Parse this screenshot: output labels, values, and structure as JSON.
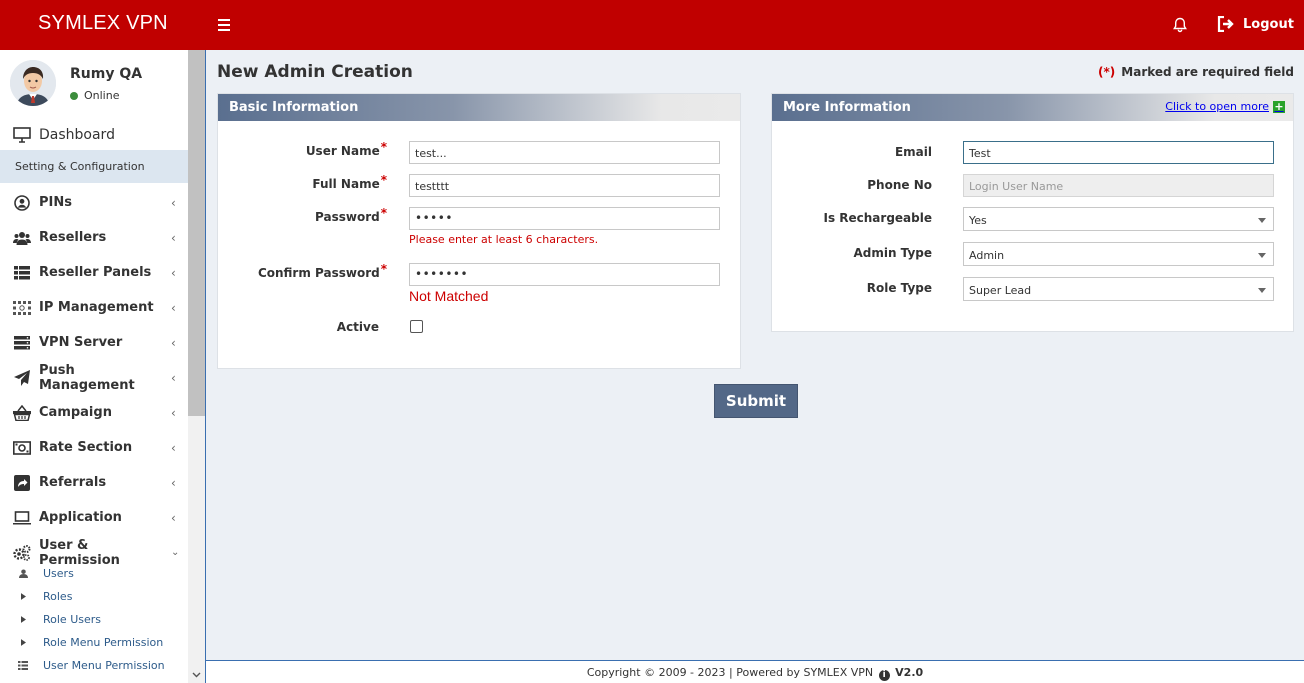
{
  "topbar": {
    "brand": "SYMLEX VPN",
    "logout_label": "Logout"
  },
  "profile": {
    "name": "Rumy QA",
    "status": "Online"
  },
  "sidebar": {
    "dashboard": "Dashboard",
    "setting_section": "Setting & Configuration",
    "items": [
      {
        "label": "PINs",
        "icon": "user-circle-icon"
      },
      {
        "label": "Resellers",
        "icon": "users-icon"
      },
      {
        "label": "Reseller Panels",
        "icon": "list-icon"
      },
      {
        "label": "IP Management",
        "icon": "ip-grid-icon"
      },
      {
        "label": "VPN Server",
        "icon": "server-icon"
      },
      {
        "label": "Push Management",
        "icon": "paper-plane-icon"
      },
      {
        "label": "Campaign",
        "icon": "basket-icon"
      },
      {
        "label": "Rate Section",
        "icon": "money-icon"
      },
      {
        "label": "Referrals",
        "icon": "share-icon"
      },
      {
        "label": "Application",
        "icon": "laptop-icon"
      },
      {
        "label": "User & Permission",
        "icon": "cogs-icon"
      }
    ],
    "sub_items": [
      {
        "label": "Users",
        "icon": "user-icon"
      },
      {
        "label": "Roles",
        "icon": "caret-right-icon"
      },
      {
        "label": "Role Users",
        "icon": "caret-right-icon"
      },
      {
        "label": "Role Menu Permission",
        "icon": "caret-right-icon"
      },
      {
        "label": "User Menu Permission",
        "icon": "list-icon"
      }
    ]
  },
  "page": {
    "title": "New Admin Creation",
    "required_mark": "(*)",
    "required_note": "Marked are required field"
  },
  "basic": {
    "heading": "Basic Information",
    "username_label": "User Name",
    "username_value": "test...",
    "fullname_label": "Full Name",
    "fullname_value": "testttt",
    "password_label": "Password",
    "password_value": "•••••",
    "password_error": "Please enter at least 6 characters.",
    "confirm_label": "Confirm Password",
    "confirm_value": "•••••••",
    "confirm_error": "Not Matched",
    "active_label": "Active",
    "active_checked": false,
    "required_star": "*"
  },
  "more": {
    "heading": "More Information",
    "open_more": "Click to open more",
    "email_label": "Email",
    "email_value": "Test",
    "phone_label": "Phone No",
    "phone_placeholder": "Login User Name",
    "recharge_label": "Is Rechargeable",
    "recharge_value": "Yes",
    "admintype_label": "Admin Type",
    "admintype_value": "Admin",
    "roletype_label": "Role Type",
    "roletype_value": "Super Lead"
  },
  "submit_label": "Submit",
  "footer": {
    "text": "Copyright © 2009 - 2023 | Powered by SYMLEX VPN",
    "version": "V2.0"
  },
  "colors": {
    "brand_red": "#c00000",
    "header_blue": "#5a6f8f",
    "error_red": "#cc0000",
    "submit_bg": "#536887"
  }
}
